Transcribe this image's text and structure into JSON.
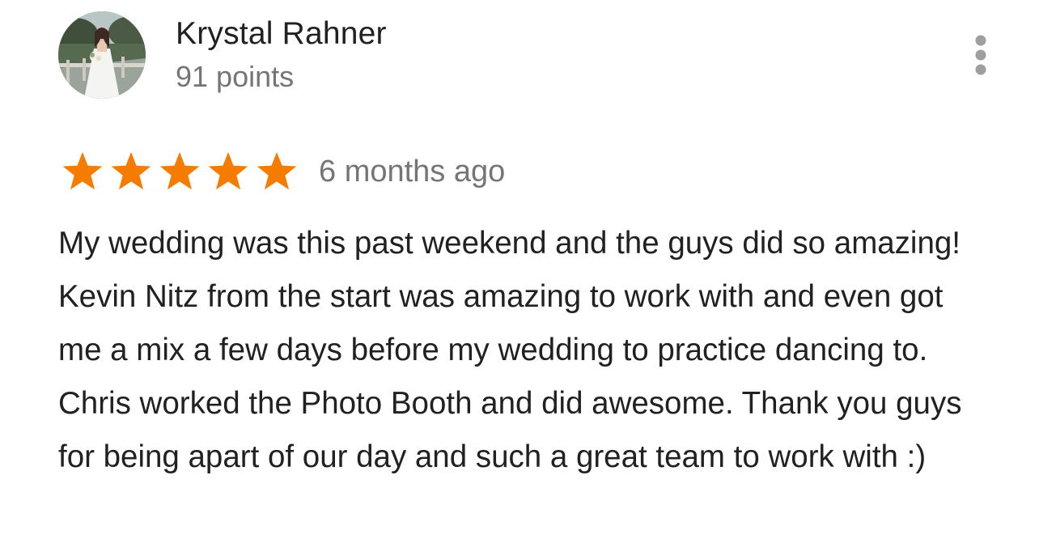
{
  "reviewer": {
    "name": "Krystal Rahner",
    "points": "91 points",
    "avatar_icon": "profile-photo-bride"
  },
  "menu": {
    "icon": "more-vert-icon"
  },
  "rating": {
    "stars": 5,
    "max_stars": 5,
    "star_color": "#f57c00",
    "date": "6 months ago"
  },
  "review": {
    "text": "My wedding was this past weekend and the guys did so amazing! Kevin Nitz from the start was amazing to work with and even got me a mix a few days before my wedding to practice dancing to. Chris worked the Photo Booth and did awesome. Thank you guys for being apart of our day and such a great team to work with :)"
  },
  "colors": {
    "primary_text": "#212121",
    "secondary_text": "#757575",
    "menu_icon": "#9e9e9e"
  }
}
